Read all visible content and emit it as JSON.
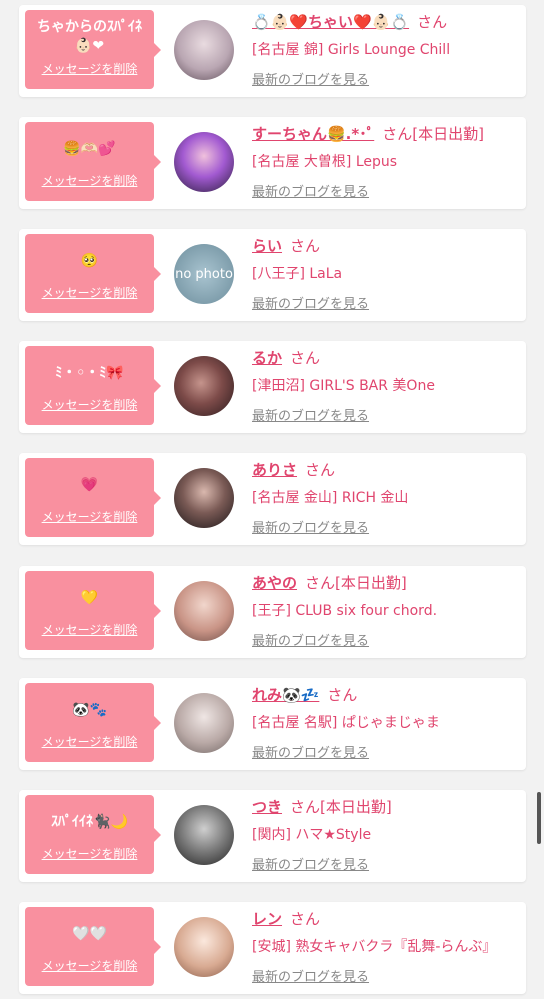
{
  "delete_label": "メッセージを削除",
  "honorific": "さん",
  "blog_link": "最新のブログを見る",
  "no_photo_text": "no photo",
  "accent_color": "#e0456e",
  "bubble_color": "#f9909f",
  "items": [
    {
      "message": "ちゃからのｽﾊﾟｲﾈ👶🏻❤",
      "name": "💍👶🏻❤️ちゃい❤️👶🏻💍",
      "status": "",
      "shop": "[名古屋 錦] Girls Lounge Chill",
      "avatar": "avatar-photo"
    },
    {
      "message": "🍔🫶🏻💕",
      "name": "すーちゃん🍔.*･ﾟ",
      "status": "[本日出勤]",
      "shop": "[名古屋 大曽根] Lepus",
      "avatar": "avatar-photo"
    },
    {
      "message": "🥺",
      "name": "らい",
      "status": "",
      "shop": "[八王子] LaLa",
      "avatar": "no-photo"
    },
    {
      "message": "ﾐ・◦・ﾐ🎀",
      "name": "るか",
      "status": "",
      "shop": "[津田沼] GIRL'S BAR 美One",
      "avatar": "avatar-photo"
    },
    {
      "message": "💗",
      "name": "ありさ",
      "status": "",
      "shop": "[名古屋 金山] RICH 金山",
      "avatar": "avatar-photo"
    },
    {
      "message": "💛",
      "name": "あやの",
      "status": "[本日出勤]",
      "shop": "[王子] CLUB six four chord.",
      "avatar": "avatar-photo"
    },
    {
      "message": "🐼🐾",
      "name": "れみ🐼💤",
      "status": "",
      "shop": "[名古屋 名駅] ぱじゃまじゃま",
      "avatar": "avatar-photo"
    },
    {
      "message": "ｽﾊﾟｲｲﾈ🐈‍⬛🌙",
      "name": "つき",
      "status": "[本日出勤]",
      "shop": "[関内] ハマ★Style",
      "avatar": "avatar-photo"
    },
    {
      "message": "🤍🤍",
      "name": "レン",
      "status": "",
      "shop": "[安城] 熟女キャバクラ『乱舞-らんぶ』",
      "avatar": "avatar-photo"
    }
  ]
}
